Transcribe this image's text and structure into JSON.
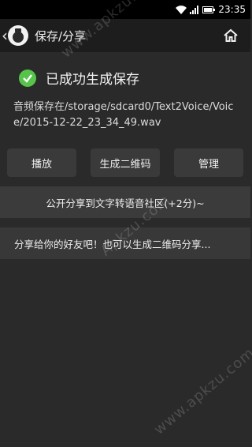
{
  "status_bar": {
    "time": "23:35"
  },
  "header": {
    "title": "保存/分享"
  },
  "success": {
    "message": "已成功生成保存"
  },
  "file": {
    "path_text": "音频保存在/storage/sdcard0/Text2Voice/Voice/2015-12-22_23_34_49.wav"
  },
  "actions": {
    "play": "播放",
    "qr": "生成二维码",
    "manage": "管理"
  },
  "share": {
    "community": "公开分享到文字转语音社区(+2分)~",
    "friends": "分享给你的好友吧！也可以生成二维码分享..."
  },
  "watermarks": [
    "www.apkzu.com",
    "Apkzu.com",
    "www.apkzu.com"
  ],
  "colors": {
    "accent_green": "#56c44b",
    "background": "#2a2a2a",
    "header": "#1d1d1d"
  }
}
